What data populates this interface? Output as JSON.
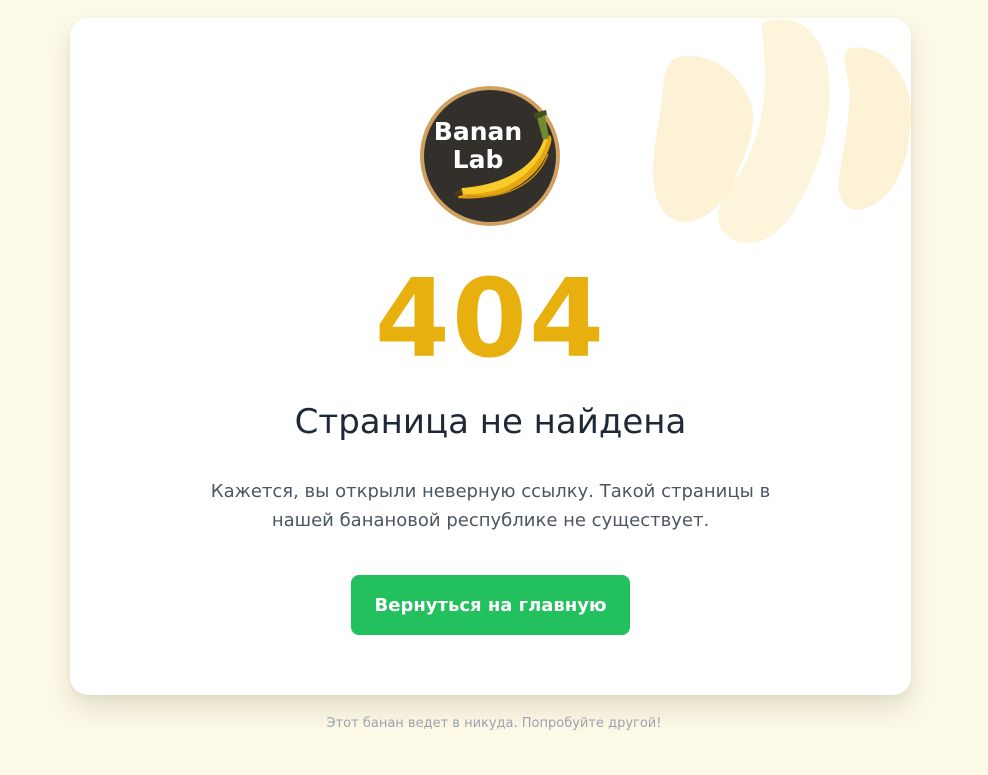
{
  "logo": {
    "line1": "Banan",
    "line2": "Lab",
    "icon": "banana-icon"
  },
  "error": {
    "code": "404",
    "title": "Страница не найдена",
    "description": "Кажется, вы открыли неверную ссылку. Такой страницы в нашей банановой республике не существует."
  },
  "actions": {
    "home_label": "Вернуться на главную"
  },
  "footer": {
    "note": "Этот банан ведет в никуда. Попробуйте другой!"
  },
  "colors": {
    "page_background": "#fdfae8",
    "card_background": "#ffffff",
    "accent_yellow": "#e8b00f",
    "button_green": "#22c15e",
    "heading": "#1e2837",
    "text_muted": "#4b5563"
  }
}
